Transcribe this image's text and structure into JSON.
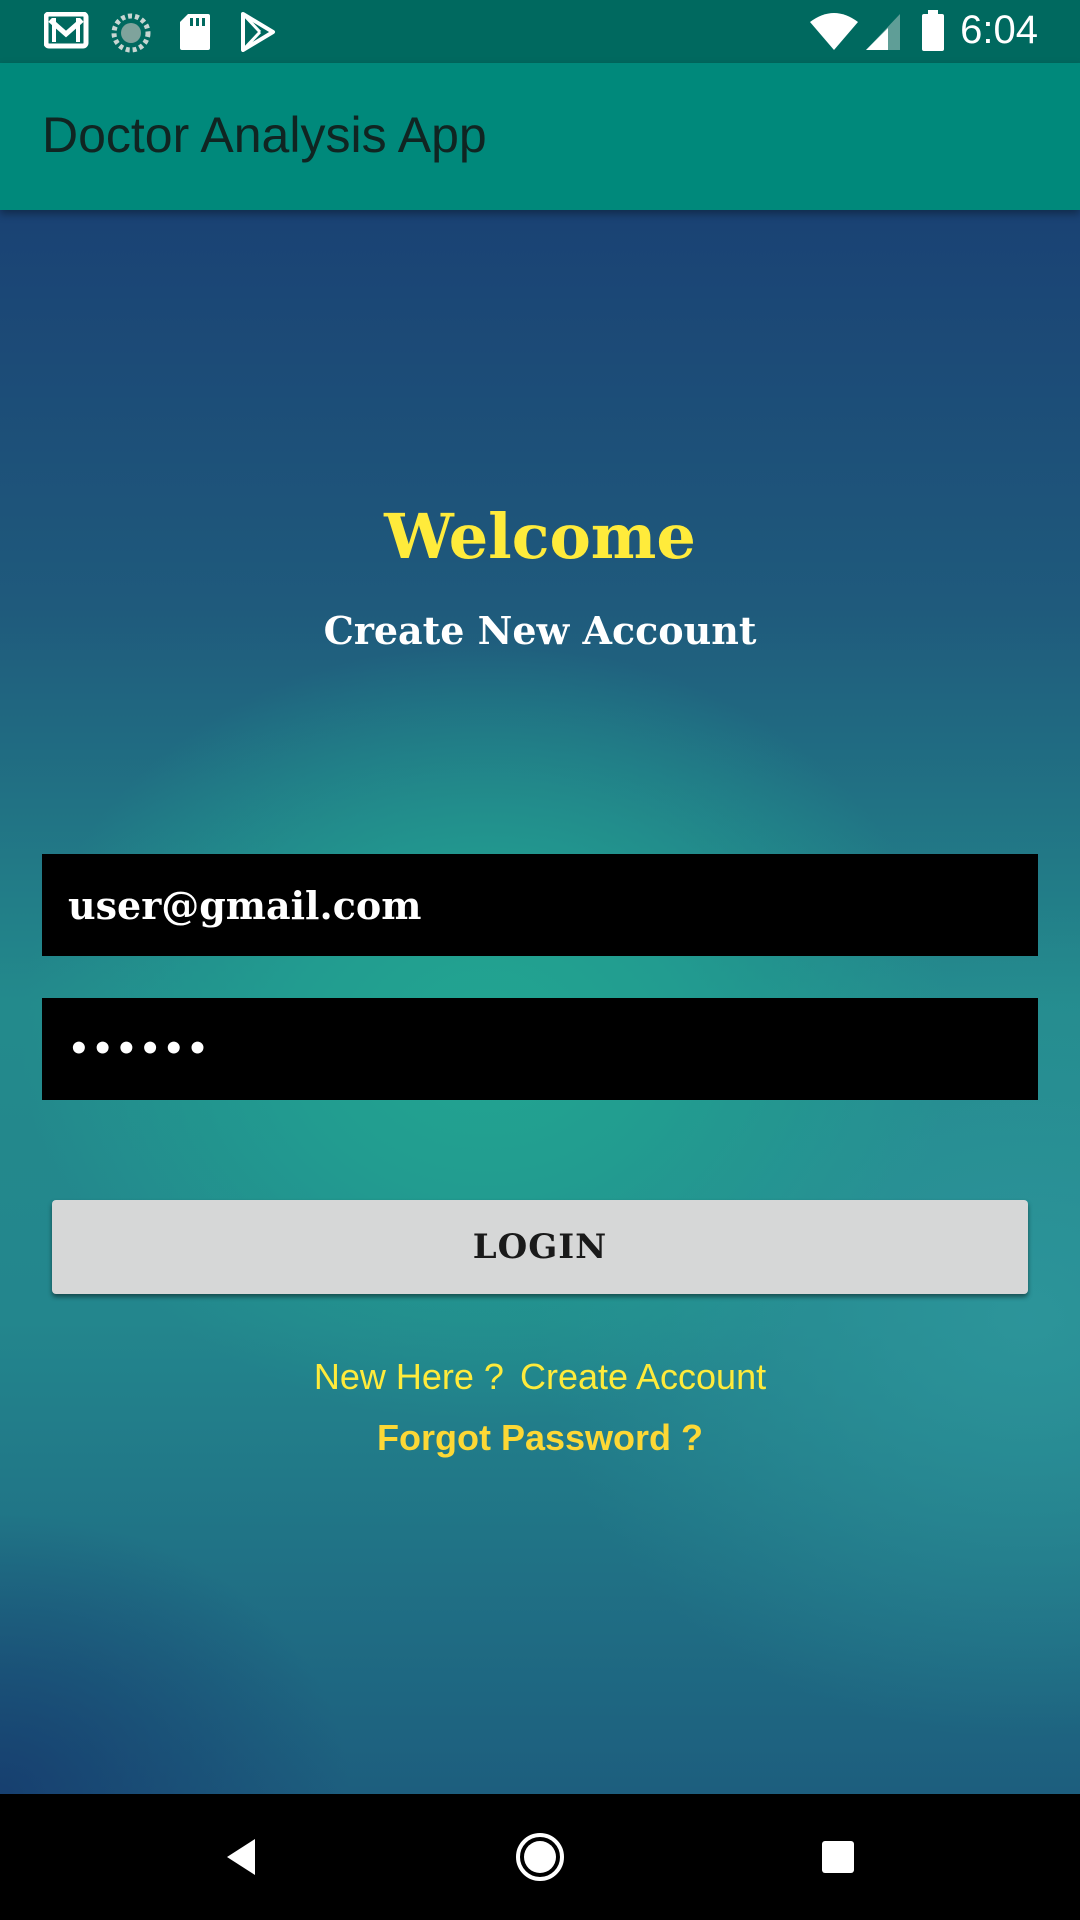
{
  "status_bar": {
    "time": "6:04",
    "left_icons": [
      "gmail-icon",
      "sync-icon",
      "sd-card-icon",
      "play-store-icon"
    ],
    "right_icons": [
      "wifi-icon",
      "signal-icon",
      "battery-icon"
    ]
  },
  "app_bar": {
    "title": "Doctor Analysis App",
    "color": "#00897b"
  },
  "main": {
    "welcome": "Welcome",
    "subtitle": "Create New Account",
    "email_value": "user@gmail.com",
    "password_value": "••••••",
    "login_label": "LOGIN",
    "new_here": "New Here ?",
    "create_account": "Create Account",
    "forgot_password": "Forgot Password ?",
    "accent_color": "#ffeb3b"
  },
  "nav_bar": {
    "icons": [
      "back-icon",
      "home-icon",
      "recents-icon"
    ]
  }
}
